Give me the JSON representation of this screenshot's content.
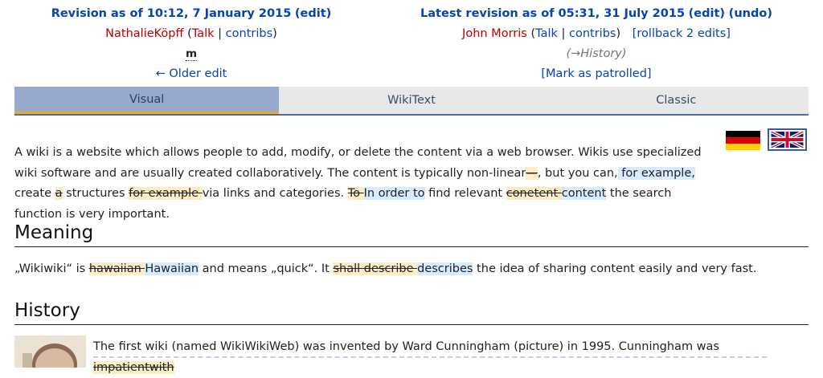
{
  "left_rev": {
    "title": "Revision as of 10:12, 7 January 2015",
    "edit": "edit",
    "user": "NathalieKöpff",
    "talk": "Talk",
    "contribs": "contribs",
    "minor": "m",
    "older": "← Older edit"
  },
  "right_rev": {
    "title": "Latest revision as of 05:31, 31 July 2015",
    "edit": "edit",
    "undo": "undo",
    "user": "John Morris",
    "talk": "Talk",
    "contribs": "contribs",
    "rollback": "[rollback 2 edits]",
    "summary": "(→History)",
    "patrol": "[Mark as patrolled]"
  },
  "tabs": [
    "Visual",
    "WikiText",
    "Classic"
  ],
  "flags": [
    "german-flag-icon",
    "uk-flag-icon"
  ],
  "content": {
    "p1": {
      "t1": "A wiki is a website which allows people to add, modify, or delete the content via a web browser. Wikis use specialized wiki software and are usually created collaboratively. The content is typically non-linear",
      "d1": "—",
      "t2": ", but you can,",
      "i1": " for example,",
      "t3": " create ",
      "d2": "a",
      "t4": " structures ",
      "d3": "for example ",
      "t5": "via links and categories. ",
      "d4": "To ",
      "i2": "In order to",
      "t6": " find relevant ",
      "d5": "conetent ",
      "i3": "content",
      "t7": " the search function is very important."
    },
    "h_meaning": "Meaning",
    "p2": {
      "t1": "„Wikiwiki“ is ",
      "d1": "hawaiian ",
      "i1": "Hawaiian",
      "t2": " and means „quick“. It ",
      "d2": "shall describe ",
      "i2": "describes",
      "t3": " the idea of sharing content easily and very fast."
    },
    "h_history": "History",
    "p3": {
      "t1": "The first wiki (named WikiWikiWeb) was invented by Ward Cunningham (picture) in 1995. Cunningham was ",
      "d1": "impatientwith"
    }
  }
}
